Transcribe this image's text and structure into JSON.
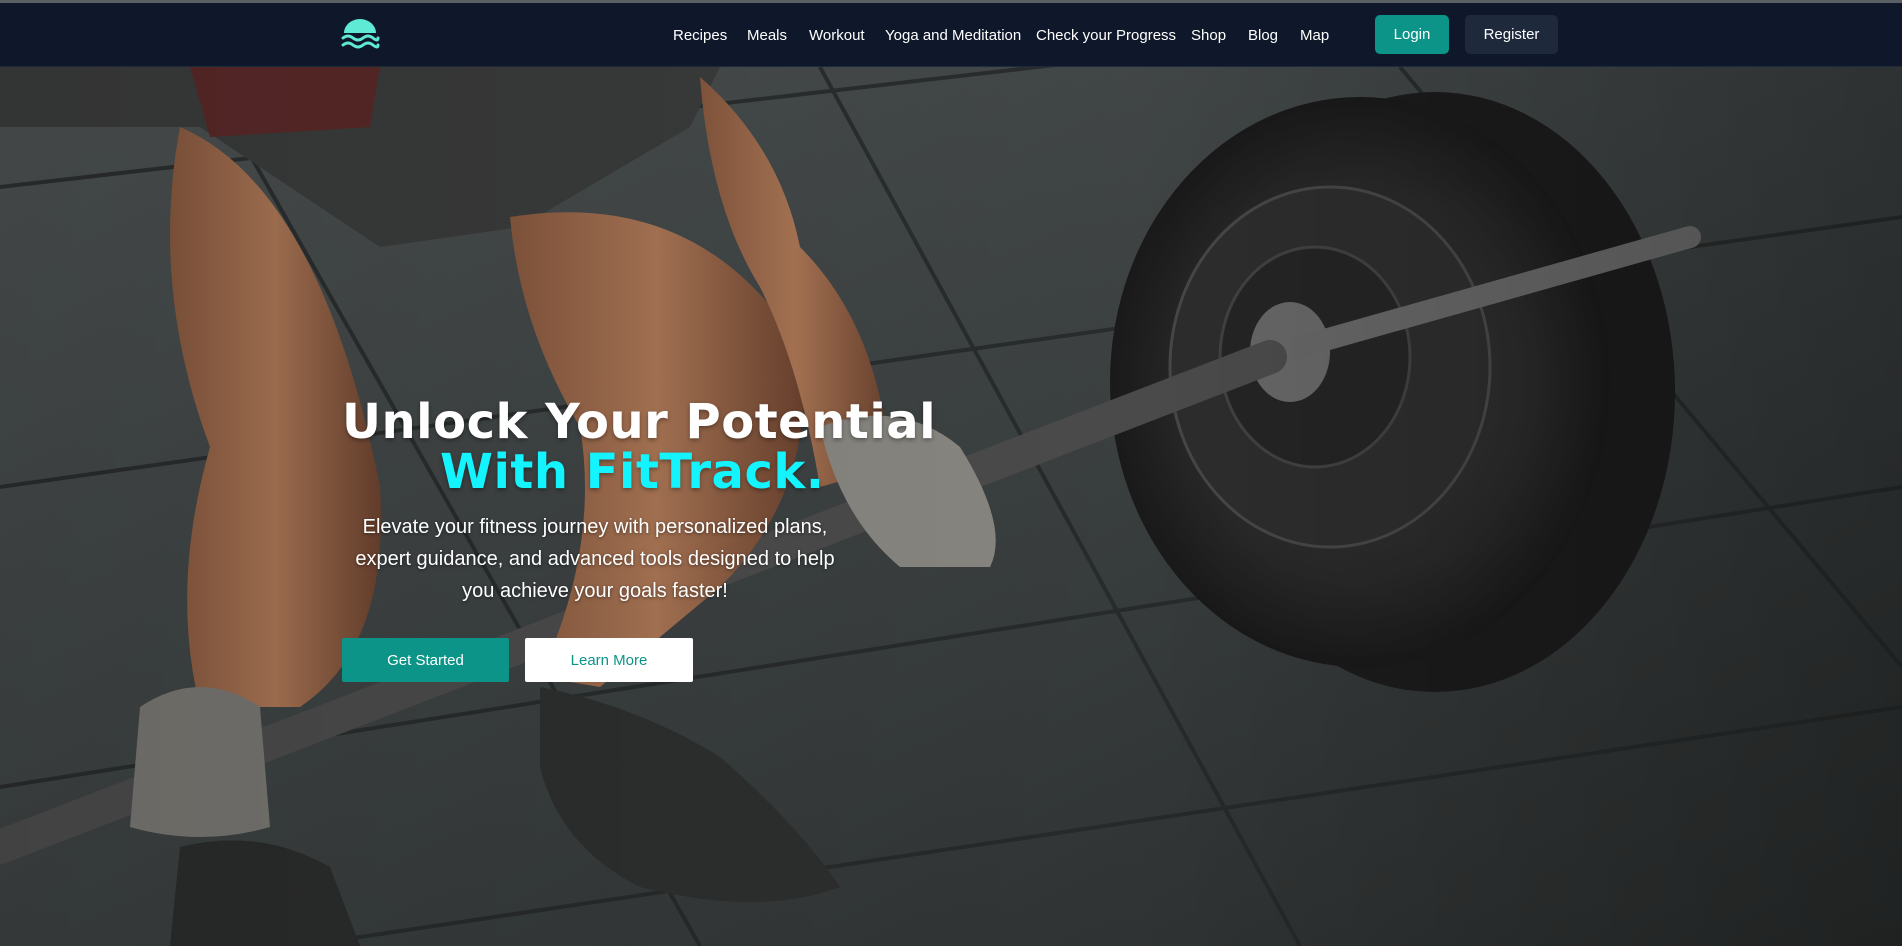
{
  "nav": {
    "logo_icon": "waves-logo-icon",
    "links": [
      "Recipes",
      "Meals",
      "Workout",
      "Yoga and Meditation",
      "Check your Progress",
      "Shop",
      "Blog",
      "Map"
    ],
    "login_label": "Login",
    "register_label": "Register"
  },
  "hero": {
    "headline_line1": "Unlock Your Potential",
    "headline_line2": "With FitTrack.",
    "subtext": "Elevate your fitness journey with personalized plans, expert guidance, and advanced tools designed to help you achieve your goals faster!",
    "get_started_label": "Get Started",
    "learn_more_label": "Learn More",
    "background_image": "athlete-deadlift-barbell-photo"
  },
  "colors": {
    "navbar_bg": "#0f172a",
    "accent_teal": "#0d9488",
    "headline_cyan": "#14f4ff",
    "logo_teal": "#5eead4",
    "register_bg": "#1e293b"
  }
}
